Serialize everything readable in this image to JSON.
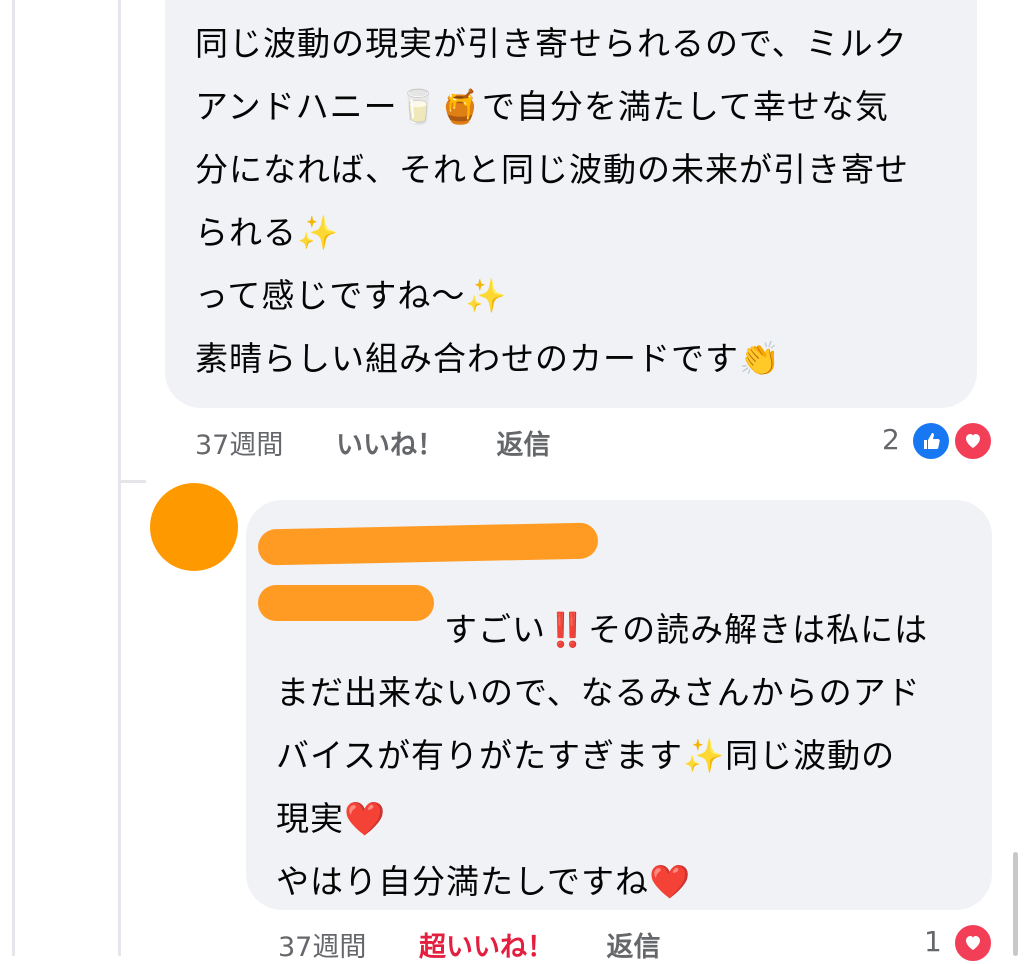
{
  "comment1": {
    "lines": [
      "同じ波動の現実が引き寄せられるので、ミルク",
      "アンドハニー🥛🍯で自分を満たして幸せな気",
      "分になれば、それと同じ波動の未来が引き寄せ",
      "られる✨",
      "って感じですね〜✨",
      "素晴らしい組み合わせのカードです👏"
    ],
    "time": "37週間",
    "like_label": "いいね！",
    "reply_label": "返信",
    "reaction_count": "2"
  },
  "comment2": {
    "lines": [
      "すごい‼️その読み解きは私には",
      "まだ出来ないので、なるみさんからのアド",
      "バイスが有りがたすぎます✨同じ波動の",
      "現実❤️",
      "やはり自分満たしですね❤️"
    ],
    "time": "37週間",
    "like_label": "超いいね！",
    "reply_label": "返信",
    "reaction_count": "1"
  },
  "icons": {
    "like": "thumbs-up-icon",
    "love": "heart-icon"
  },
  "colors": {
    "like": "#1877f2",
    "love": "#f33e58",
    "super_like_text": "#e41e3f",
    "redaction": "#ff9a22"
  }
}
